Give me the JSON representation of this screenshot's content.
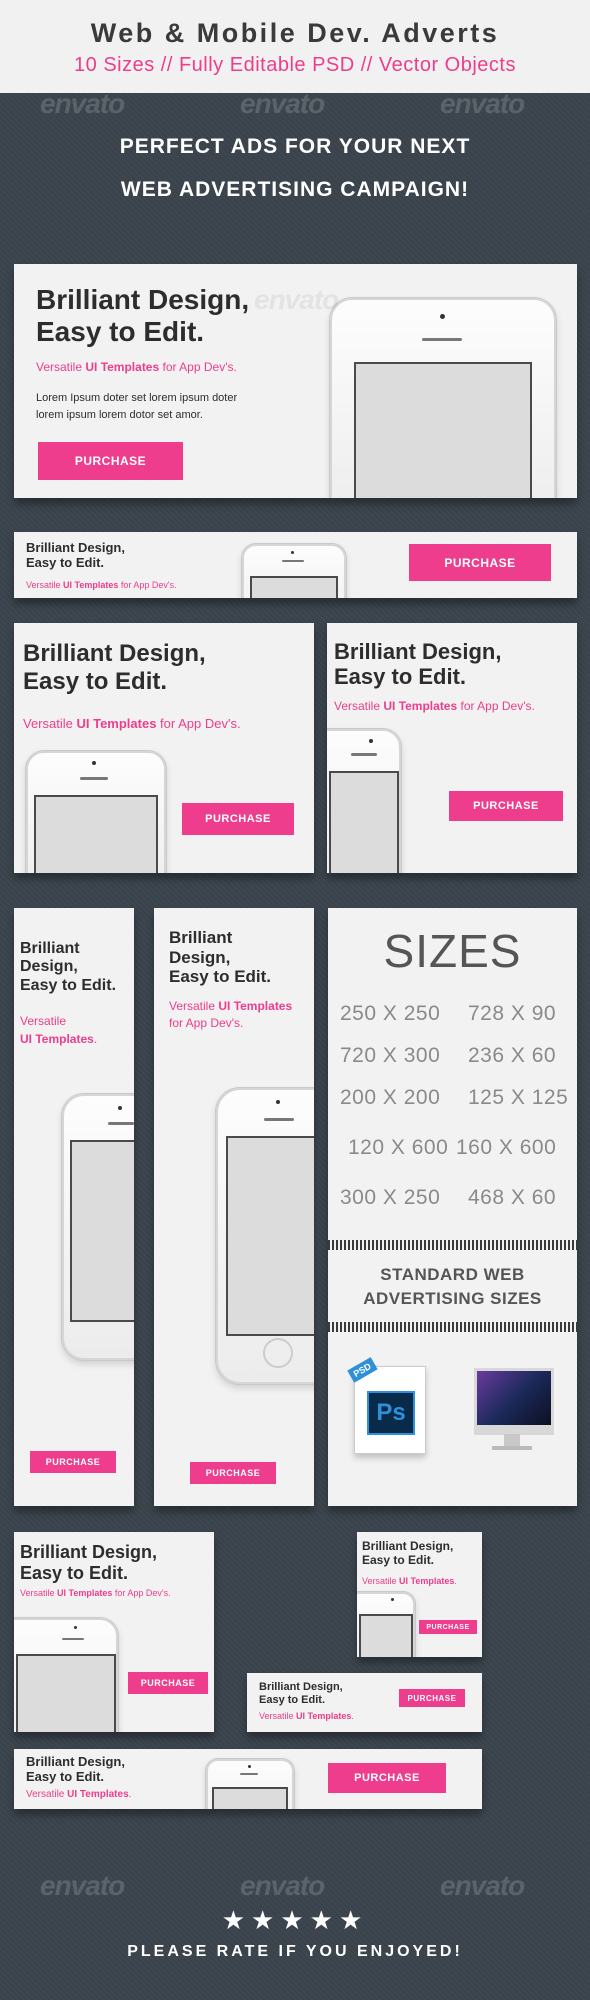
{
  "header": {
    "title": "Web & Mobile Dev. Adverts",
    "subtitle": "10 Sizes // Fully Editable PSD // Vector Objects"
  },
  "headline": {
    "line1": "PERFECT ADS FOR YOUR NEXT",
    "line2": "WEB ADVERTISING CAMPAIGN!"
  },
  "watermark": "envato",
  "ad": {
    "title_line1": "Brilliant Design,",
    "title_line2": "Easy to Edit.",
    "title_word1": "Brilliant",
    "title_word2": "Design,",
    "tagline_pre": "Versatile ",
    "tagline_bold": "UI Templates",
    "tagline_post": " for App Dev's.",
    "tagline_short_post": ".",
    "tagline_word1": "Versatile",
    "lorem_line1": "Lorem Ipsum doter set lorem ipsum doter",
    "lorem_line2": "lorem ipsum lorem dotor set amor.",
    "purchase": "PURCHASE"
  },
  "sizes": {
    "heading": "SIZES",
    "items": [
      "250 X 250",
      "728 X 90",
      "720 X 300",
      "236 X 60",
      "200 X 200",
      "125 X 125",
      "120 X 600",
      "160 X 600",
      "300 X 250",
      "468 X 60"
    ],
    "standard_line1": "STANDARD WEB",
    "standard_line2": "ADVERTISING SIZES",
    "ps_badge": "PSD",
    "ps_letters": "Ps"
  },
  "footer": {
    "stars": "★★★★★",
    "rate_text": "PLEASE RATE IF YOU ENJOYED!"
  },
  "colors": {
    "accent": "#ee3d8c",
    "background": "#3d464f",
    "panel": "#f2f2f2"
  }
}
